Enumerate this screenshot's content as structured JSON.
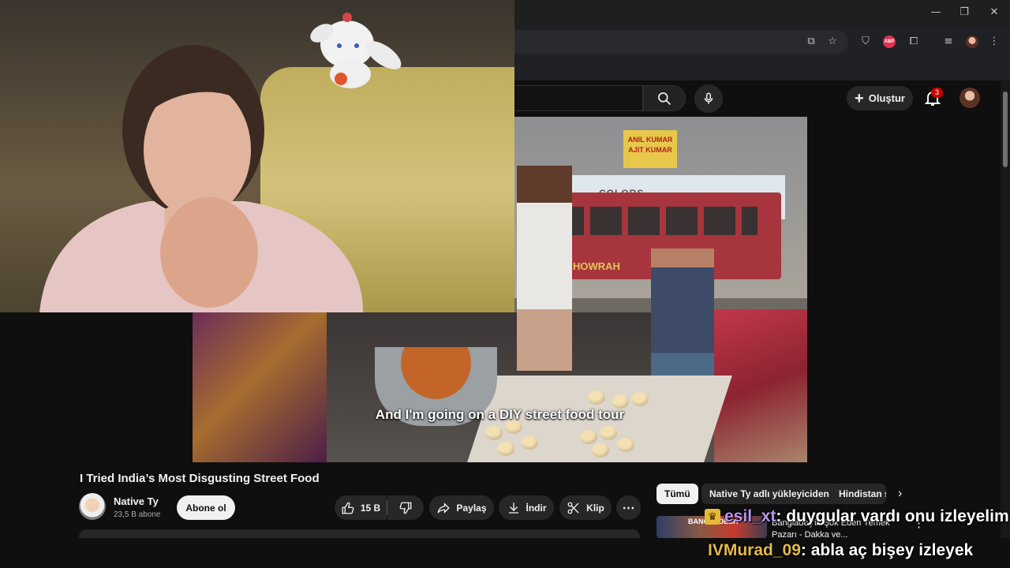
{
  "browser": {
    "window_controls": {
      "minimize": "—",
      "restore": "❐",
      "close": "✕"
    },
    "extension_badge": "ABP"
  },
  "youtube": {
    "header": {
      "create_label": "Oluştur",
      "notification_count": "3"
    },
    "video": {
      "caption": "And I'm going on a DIY street food tour",
      "title": "I Tried India’s Most Disgusting Street Food",
      "channel_name": "Native Ty",
      "subscribers": "23,5 B abone",
      "subscribe_label": "Abone ol",
      "likes": "15 B",
      "share_label": "Paylaş",
      "download_label": "İndir",
      "clip_label": "Klip",
      "more_label": "⋯"
    },
    "chips": [
      {
        "label": "Tümü"
      },
      {
        "label": "Native Ty adlı yükleyiciden"
      },
      {
        "label": "Hindistan s"
      }
    ],
    "recommendation": {
      "thumb_text": "BANGLADESH",
      "title": "Bangladeş'in Şok Eden Yemek Pazarı - Dakka ve..."
    },
    "scene_signs": {
      "shop_sign": "ANIL KUMAR AJIT KUMAR",
      "billboard": "COLORS",
      "bus_text": "HOWRAH"
    }
  },
  "chat": [
    {
      "user": "esil_xt",
      "message": ": duygular vardı onu izleyelim"
    },
    {
      "user": "IVMurad_09",
      "message": ": abla aç bişey izleyek"
    }
  ],
  "colors": {
    "chat_user1": "#b797ee",
    "chat_user2": "#e3b94a",
    "notification_badge": "#cc0000",
    "background": "#0f0f0f"
  }
}
